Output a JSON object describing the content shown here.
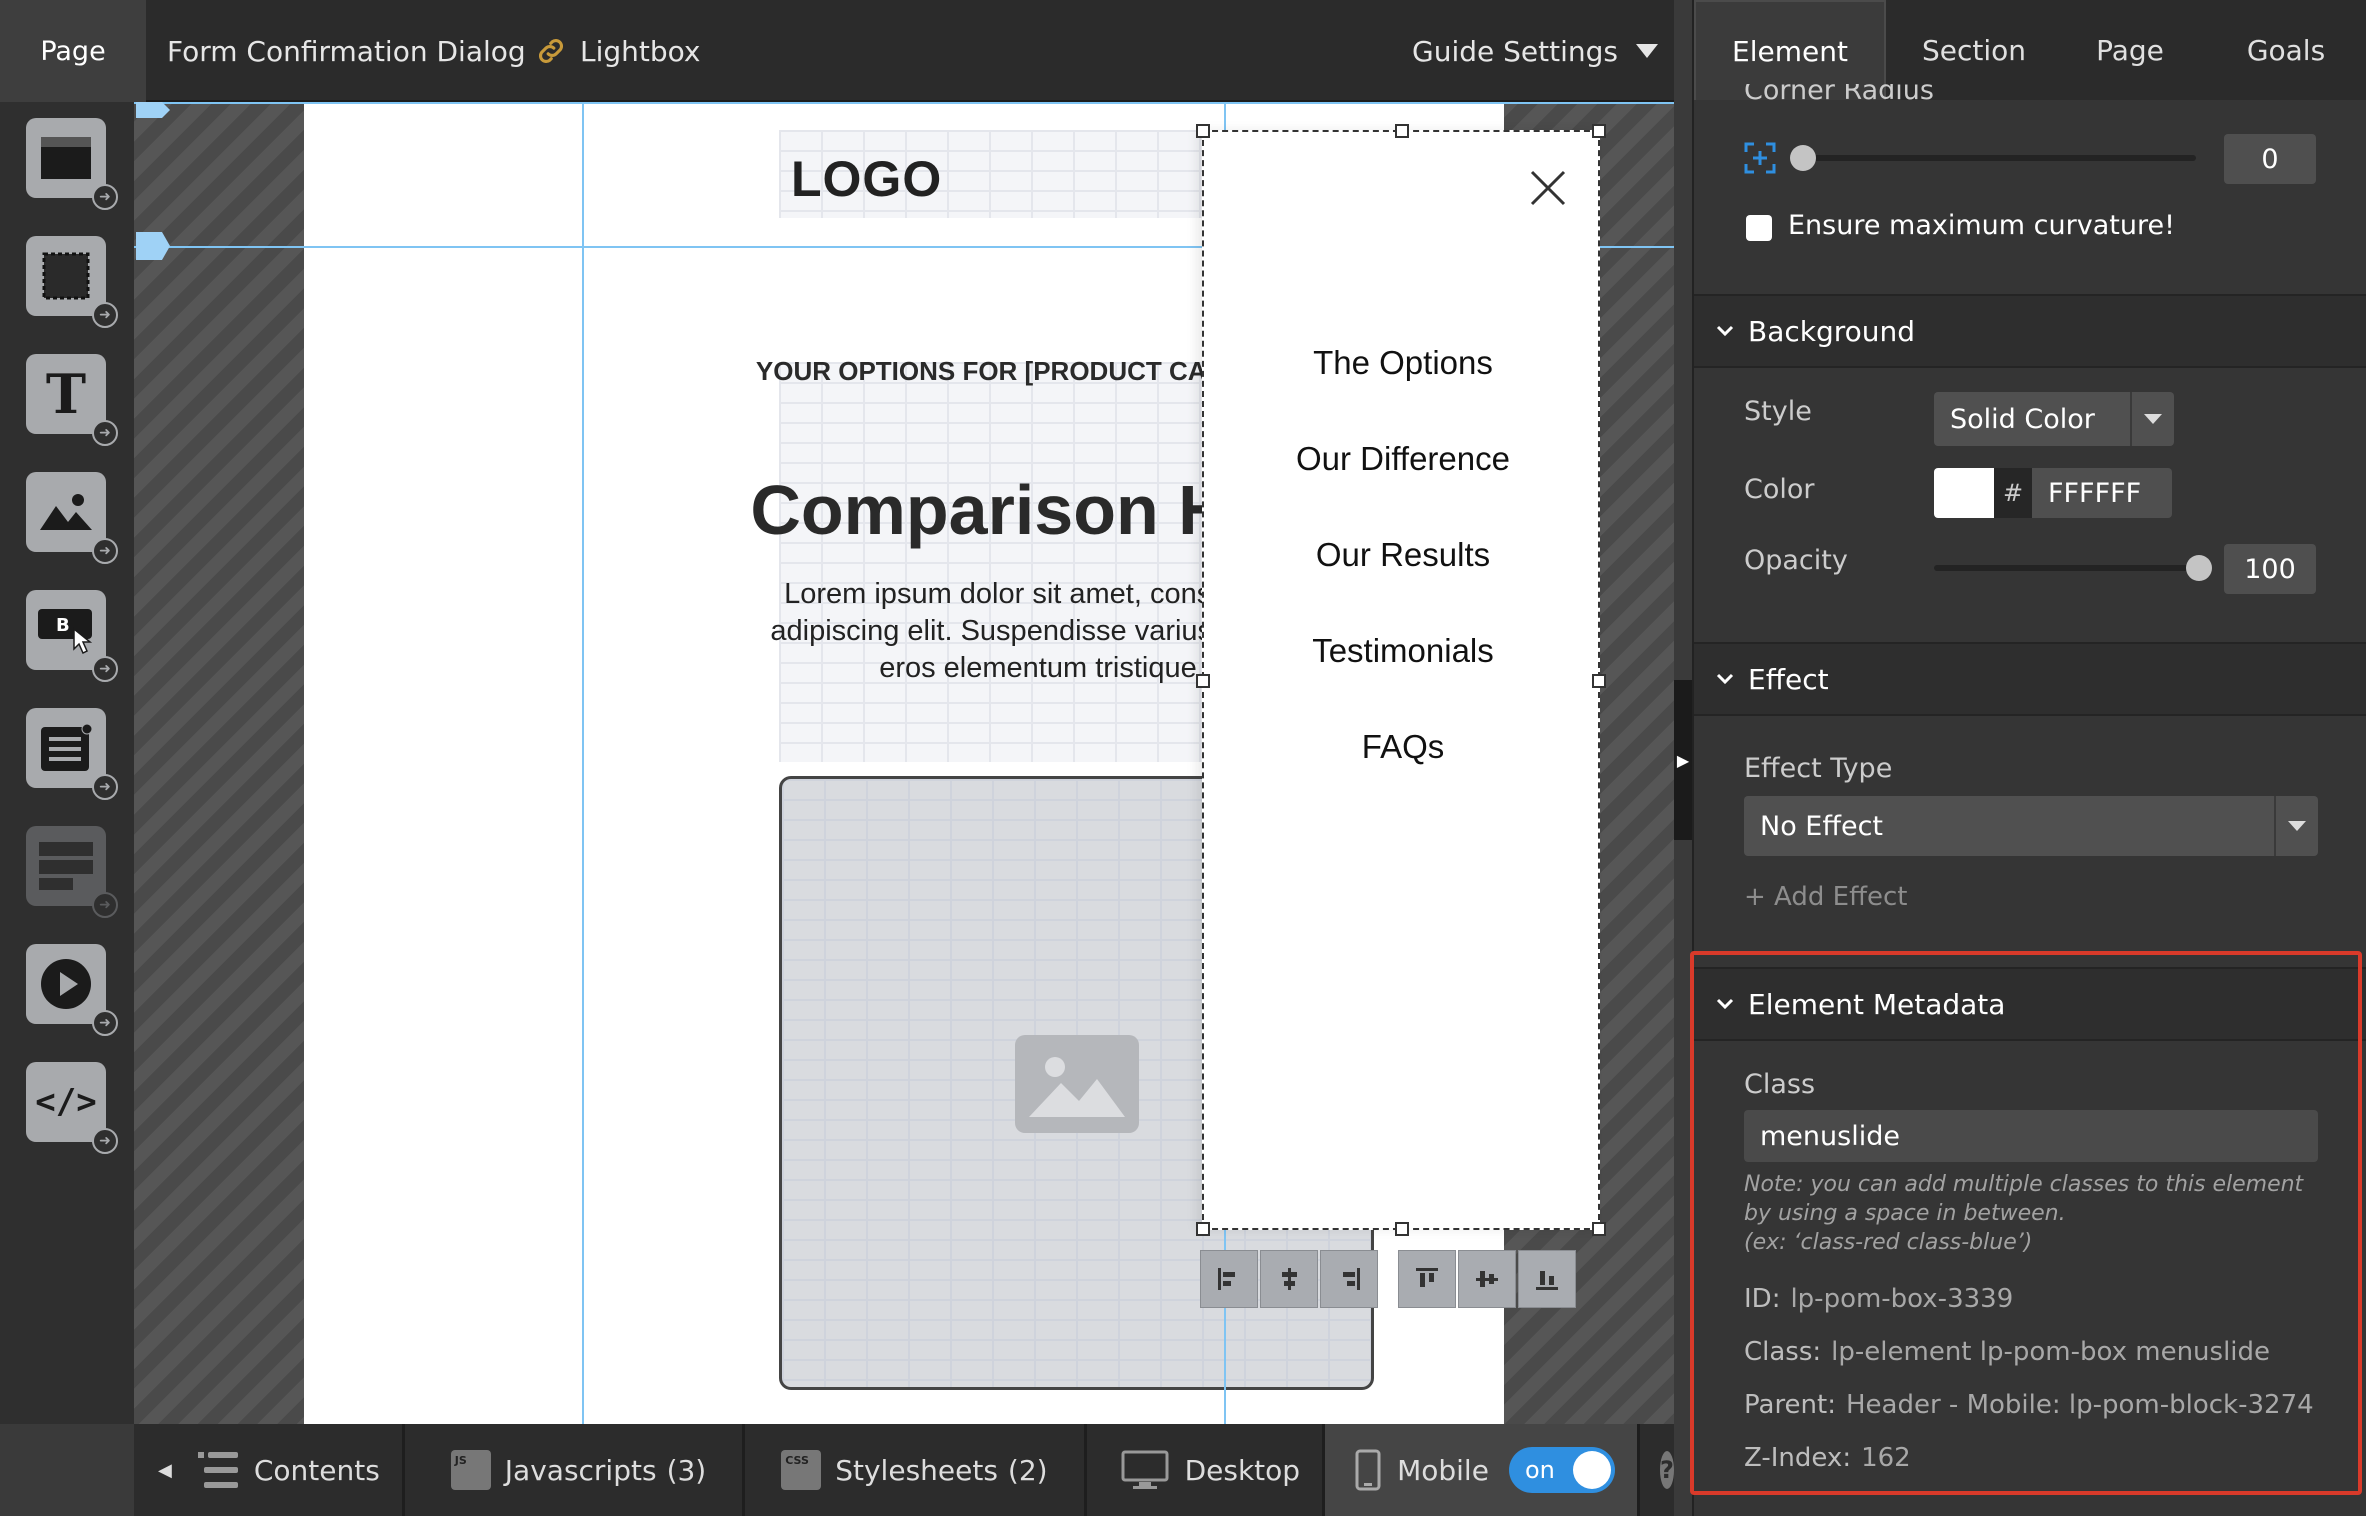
{
  "topbar": {
    "page_tab": "Page",
    "form_confirmation": "Form Confirmation Dialog",
    "lightbox": "Lightbox",
    "guide_settings": "Guide Settings"
  },
  "tools": [
    {
      "name": "section-tool",
      "icon": "section-icon"
    },
    {
      "name": "box-tool",
      "icon": "box-icon"
    },
    {
      "name": "text-tool",
      "icon": "text-icon",
      "glyph": "T"
    },
    {
      "name": "image-tool",
      "icon": "image-icon"
    },
    {
      "name": "button-tool",
      "icon": "button-icon",
      "glyph": "B"
    },
    {
      "name": "form-tool",
      "icon": "form-icon"
    },
    {
      "name": "widget-tool",
      "icon": "widget-icon"
    },
    {
      "name": "video-tool",
      "icon": "video-icon"
    },
    {
      "name": "custom-html-tool",
      "icon": "code-icon",
      "glyph": "</>"
    }
  ],
  "canvas": {
    "logo": "LOGO",
    "eyebrow": "YOUR OPTIONS FOR [PRODUCT CATEGORY]",
    "hero_title": "Comparison Hero",
    "hero_body": "Lorem ipsum dolor sit amet, consectetur adipiscing elit. Suspendisse varius enim in eros elementum tristique.",
    "menu_links": [
      "The Options",
      "Our Difference",
      "Our Results",
      "Testimonials",
      "FAQs"
    ]
  },
  "bottombar": {
    "contents": "Contents",
    "javascripts": "Javascripts",
    "javascripts_count": "(3)",
    "js_badge": "JS",
    "stylesheets": "Stylesheets",
    "stylesheets_count": "(2)",
    "css_badge": "CSS",
    "desktop": "Desktop",
    "mobile": "Mobile",
    "mobile_toggle": "on",
    "help": "?"
  },
  "panel": {
    "tabs": [
      "Element",
      "Section",
      "Page",
      "Goals"
    ],
    "corner_radius_label": "Corner Radius",
    "corner_radius_value": "0",
    "ensure_curvature": "Ensure maximum curvature!",
    "background": {
      "title": "Background",
      "style_label": "Style",
      "style_value": "Solid Color",
      "color_label": "Color",
      "color_hash": "#",
      "color_value": "FFFFFF",
      "opacity_label": "Opacity",
      "opacity_value": "100"
    },
    "effect": {
      "title": "Effect",
      "type_label": "Effect Type",
      "type_value": "No Effect",
      "add_effect": "+ Add Effect"
    },
    "metadata": {
      "title": "Element Metadata",
      "class_label": "Class",
      "class_value": "menuslide",
      "note": "Note: you can add multiple classes to this element by using a space in between.",
      "note_example": "(ex: ‘class-red class-blue’)",
      "id_label": "ID:",
      "id_value": "lp-pom-box-3339",
      "classes_label": "Class:",
      "classes_value": "lp-element lp-pom-box menuslide",
      "parent_label": "Parent:",
      "parent_value": "Header - Mobile: lp-pom-block-3274",
      "zindex_label": "Z-Index:",
      "zindex_value": "162"
    }
  },
  "colors": {
    "accent_blue": "#2f8fe0",
    "highlight_red": "#d93a2a",
    "guide_blue": "#7fc4f3"
  }
}
